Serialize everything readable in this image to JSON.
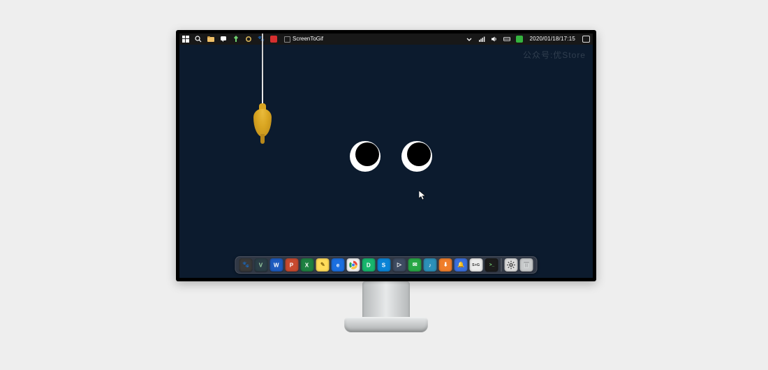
{
  "taskbar": {
    "app_label": "ScreenToGif",
    "clock": "2020/01/18/17:15",
    "left_icons": [
      {
        "name": "start-icon"
      },
      {
        "name": "search-icon"
      },
      {
        "name": "file-explorer-icon"
      },
      {
        "name": "chat-icon"
      },
      {
        "name": "pin-icon"
      },
      {
        "name": "ring-icon"
      },
      {
        "name": "paw-icon"
      },
      {
        "name": "red-app-icon"
      }
    ],
    "right_icons": [
      {
        "name": "chevron-up-icon"
      },
      {
        "name": "wifi-icon"
      },
      {
        "name": "volume-icon"
      },
      {
        "name": "keyboard-icon"
      },
      {
        "name": "green-app-icon"
      },
      {
        "name": "notifications-icon"
      }
    ]
  },
  "watermark": "公众号:优Store",
  "wallpaper": {
    "eyes": {
      "pupil_direction": "up-right"
    },
    "pullcord": {
      "color": "#d9a521"
    }
  },
  "dock": {
    "items": [
      {
        "name": "finder-paw-icon",
        "label": "🐾"
      },
      {
        "name": "vim-icon",
        "label": "V"
      },
      {
        "name": "word-icon",
        "label": "W"
      },
      {
        "name": "powerpoint-icon",
        "label": "P"
      },
      {
        "name": "excel-icon",
        "label": "X"
      },
      {
        "name": "pencil-icon",
        "label": "✎"
      },
      {
        "name": "edge-icon",
        "label": "e"
      },
      {
        "name": "chrome-icon",
        "label": ""
      },
      {
        "name": "green-d-icon",
        "label": "D"
      },
      {
        "name": "skype-icon",
        "label": "S"
      },
      {
        "name": "video-icon",
        "label": "▷"
      },
      {
        "name": "wechat-icon",
        "label": "✉"
      },
      {
        "name": "music-net-icon",
        "label": "♪"
      },
      {
        "name": "download-icon",
        "label": "⬇"
      },
      {
        "name": "todo-bell-icon",
        "label": "🔔"
      },
      {
        "name": "snip-tool-icon",
        "label": "S+G"
      },
      {
        "name": "terminal-icon",
        "label": ">_"
      },
      {
        "name": "settings-icon",
        "label": ""
      },
      {
        "name": "trash-icon",
        "label": ""
      }
    ]
  }
}
